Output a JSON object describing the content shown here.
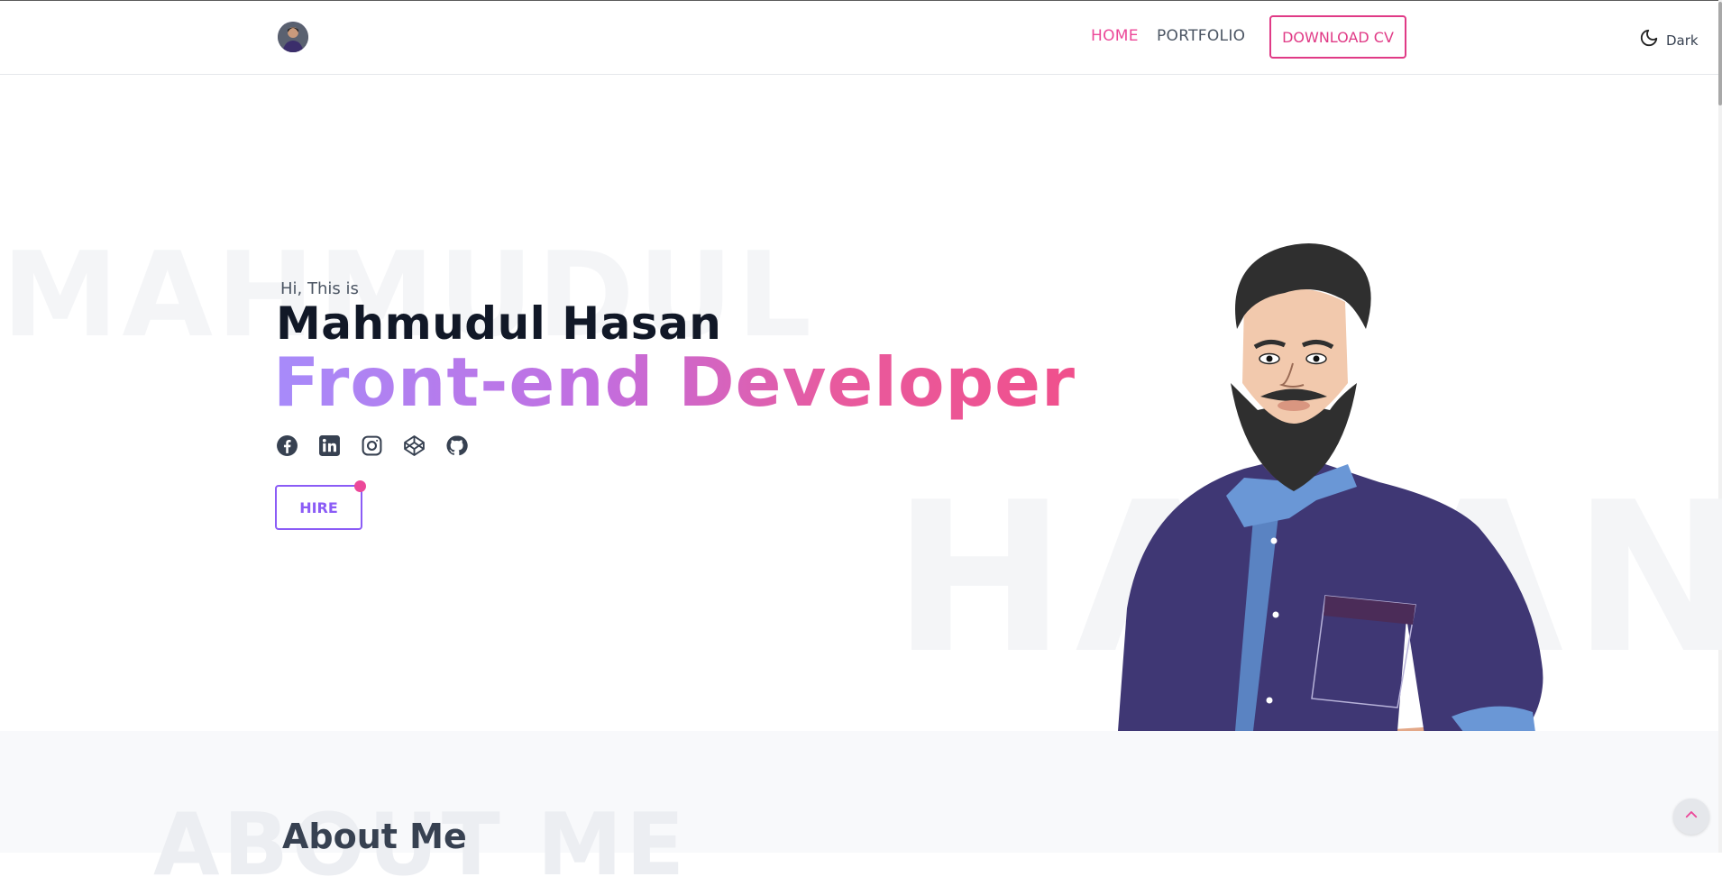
{
  "header": {
    "nav": {
      "home": "HOME",
      "portfolio": "PORTFOLIO"
    },
    "download_cv": "DOWNLOAD CV",
    "theme": {
      "label": "Dark",
      "icon": "moon-icon"
    }
  },
  "hero": {
    "greeting": "Hi, This is",
    "name": "Mahmudul Hasan",
    "role": "Front-end Developer",
    "bg_word_1": "MAHMUDUL",
    "bg_word_2": "HASAN",
    "socials": [
      {
        "icon": "facebook-icon"
      },
      {
        "icon": "linkedin-icon"
      },
      {
        "icon": "instagram-icon"
      },
      {
        "icon": "codepen-icon"
      },
      {
        "icon": "github-icon"
      }
    ],
    "hire": "HIRE",
    "gradient": [
      "#a78bfa",
      "#ec4899"
    ]
  },
  "about": {
    "title": "About Me",
    "bg_word": "ABOUT ME"
  },
  "colors": {
    "accent": "#ec4899",
    "secondary": "#8b5cf6"
  }
}
